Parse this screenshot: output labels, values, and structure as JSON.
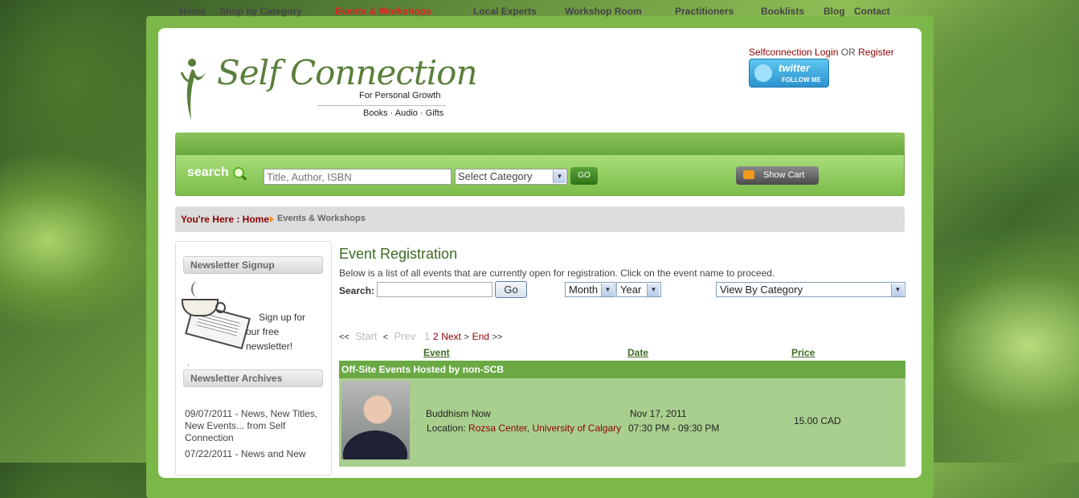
{
  "logo": {
    "title": "Self Connection",
    "tagline": "For Personal Growth",
    "products": "Books · Audio · Gifts"
  },
  "account": {
    "login_label": "Selfconnection Login",
    "or_label": "OR",
    "register_label": "Register"
  },
  "twitter": {
    "label": "twitter",
    "sub": "FOLLOW ME"
  },
  "nav": [
    "Home",
    "Shop by Category",
    "Events & Workshops",
    "Local Experts",
    "Workshop Room",
    "Practitioners",
    "Booklists",
    "Blog",
    "Contact"
  ],
  "nav_active": "Events & Workshops",
  "search": {
    "label": "search",
    "placeholder": "Title, Author, ISBN",
    "category_selected": "Select Category",
    "go_label": "GO",
    "cart_label": "Show Cart"
  },
  "breadcrumb": {
    "prefix": "You're Here : Home",
    "current": "Events & Workshops"
  },
  "sidebar": {
    "newsletter_heading": "Newsletter Signup",
    "signup_line1": "Sign up for",
    "signup_line2": "our free",
    "signup_line3": "newsletter!",
    "dot": ".",
    "archives_heading": "Newsletter Archives",
    "archives": [
      "09/07/2011 - News, New Titles, New Events... from Self Connection",
      "07/22/2011 - News and New"
    ]
  },
  "events": {
    "title": "Event Registration",
    "intro": "Below is a list of all events that are currently open for registration. Click on the event name to proceed.",
    "search_label": "Search:",
    "go_label": "Go",
    "month_selected": "Month",
    "year_selected": "Year",
    "category_selected": "View By Category",
    "pager": {
      "first": "<<",
      "start": "Start",
      "prev_arrow": "<",
      "prev": "Prev",
      "current": "1",
      "next_page": "2",
      "next": "Next",
      "next_arrow": ">",
      "end": "End",
      "last": ">>"
    },
    "columns": {
      "event": "Event",
      "date": "Date",
      "price": "Price"
    },
    "group": "Off-Site Events Hosted by non-SCB",
    "items": [
      {
        "name": "Buddhism Now",
        "location_label": "Location:",
        "venue": "Rozsa Center",
        "comma": ",",
        "institution": "University of Calgary",
        "date": "Nov 17, 2011",
        "time": "07:30 PM - 09:30 PM",
        "price": "15.00 CAD"
      }
    ]
  },
  "colors": {
    "brand_green": "#5a7f3a",
    "nav_active": "#e21f1f",
    "link_red": "#8b0000",
    "group_row": "#6aa944",
    "event_row": "#a9cf8e"
  }
}
